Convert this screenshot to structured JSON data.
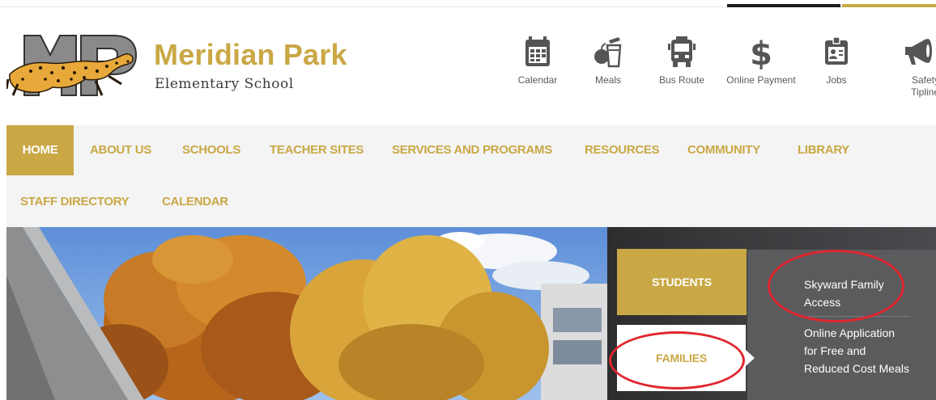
{
  "header": {
    "school_name": "Meridian Park",
    "school_subtitle": "Elementary School",
    "logo_letters": "MP"
  },
  "quick_links": [
    {
      "label": "Calendar",
      "icon": "calendar-icon"
    },
    {
      "label": "Meals",
      "icon": "meals-icon"
    },
    {
      "label": "Bus Route",
      "icon": "bus-icon"
    },
    {
      "label": "Online Payment",
      "icon": "dollar-icon"
    },
    {
      "label": "Jobs",
      "icon": "id-badge-icon"
    },
    {
      "label": "Safety Tipline",
      "icon": "megaphone-icon"
    }
  ],
  "nav": {
    "items": [
      {
        "label": "HOME",
        "active": true
      },
      {
        "label": "ABOUT US"
      },
      {
        "label": "SCHOOLS"
      },
      {
        "label": "TEACHER SITES"
      },
      {
        "label": "SERVICES AND PROGRAMS"
      },
      {
        "label": "RESOURCES"
      },
      {
        "label": "COMMUNITY"
      },
      {
        "label": "LIBRARY"
      },
      {
        "label": "STAFF DIRECTORY"
      },
      {
        "label": "CALENDAR"
      }
    ]
  },
  "audience_panel": {
    "students_label": "STUDENTS",
    "families_label": "FAMILIES",
    "links": [
      {
        "label": "Skyward Family Access"
      },
      {
        "label": "Online Application for Free and Reduced Cost Meals"
      }
    ]
  },
  "colors": {
    "brand_gold": "#c9a845",
    "annotation_red": "#e0262e"
  }
}
